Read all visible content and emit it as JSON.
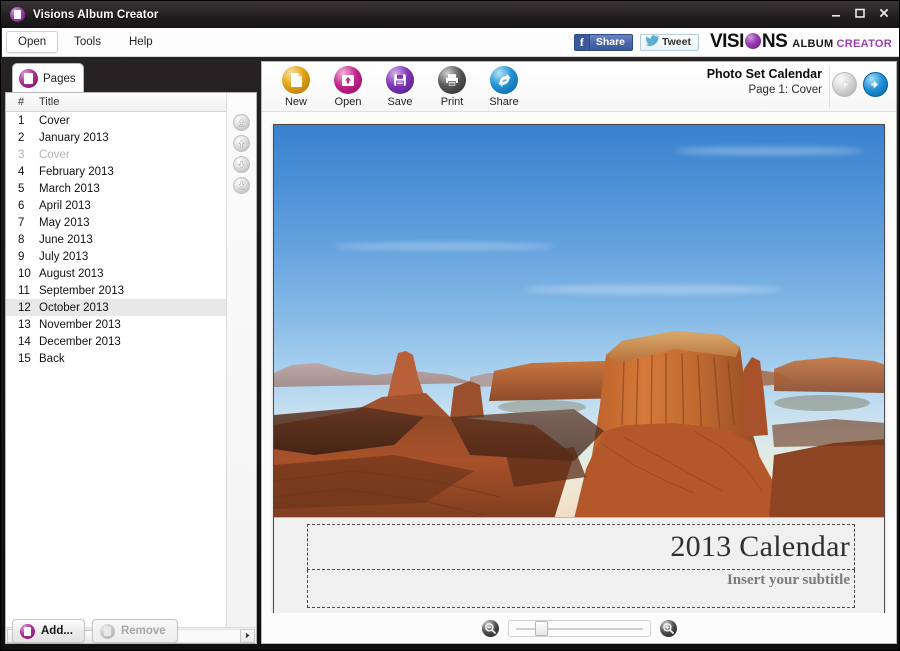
{
  "window": {
    "title": "Visions Album Creator",
    "app_icon": "page-orb-icon",
    "minimize": "minimize-icon",
    "maximize": "maximize-icon",
    "close": "close-icon"
  },
  "menubar": {
    "items": [
      {
        "label": "Open",
        "active": true
      },
      {
        "label": "Tools",
        "active": false
      },
      {
        "label": "Help",
        "active": false
      }
    ],
    "social": {
      "facebook_label": "Share",
      "facebook_glyph": "f",
      "twitter_label": "Tweet"
    },
    "logo": {
      "part1": "VISI",
      "part2": "NS",
      "album": "ALBUM",
      "creator": "CREATOR",
      "orb_color": "#9a3fb4"
    }
  },
  "sidebar": {
    "tab": {
      "label": "Pages",
      "icon": "pages-icon"
    },
    "columns": {
      "num": "#",
      "title": "Title"
    },
    "pages": [
      {
        "num": "1",
        "title": "Cover",
        "state": "normal"
      },
      {
        "num": "2",
        "title": "January 2013",
        "state": "normal"
      },
      {
        "num": "3",
        "title": "Cover",
        "state": "disabled"
      },
      {
        "num": "4",
        "title": "February 2013",
        "state": "normal"
      },
      {
        "num": "5",
        "title": "March 2013",
        "state": "normal"
      },
      {
        "num": "6",
        "title": "April 2013",
        "state": "normal"
      },
      {
        "num": "7",
        "title": "May 2013",
        "state": "normal"
      },
      {
        "num": "8",
        "title": "June 2013",
        "state": "normal"
      },
      {
        "num": "9",
        "title": "July 2013",
        "state": "normal"
      },
      {
        "num": "10",
        "title": "August 2013",
        "state": "normal"
      },
      {
        "num": "11",
        "title": "September 2013",
        "state": "normal"
      },
      {
        "num": "12",
        "title": "October 2013",
        "state": "hover"
      },
      {
        "num": "13",
        "title": "November 2013",
        "state": "normal"
      },
      {
        "num": "14",
        "title": "December 2013",
        "state": "normal"
      },
      {
        "num": "15",
        "title": "Back",
        "state": "normal"
      }
    ],
    "reorder_buttons": [
      {
        "name": "move-to-top-button",
        "icon": "arrow-up-to-bar-icon",
        "enabled": false
      },
      {
        "name": "move-up-button",
        "icon": "arrow-up-icon",
        "enabled": false
      },
      {
        "name": "move-down-button",
        "icon": "arrow-down-icon",
        "enabled": false
      },
      {
        "name": "move-to-bottom-button",
        "icon": "arrow-down-to-bar-icon",
        "enabled": false
      }
    ],
    "hscroll": {
      "left_arrow": "triangle-left-icon",
      "right_arrow": "triangle-right-icon",
      "thumb_grip": "|||"
    },
    "add_button": {
      "label": "Add...",
      "enabled": true
    },
    "remove_button": {
      "label": "Remove",
      "enabled": false
    }
  },
  "toolbar": {
    "tools": [
      {
        "label": "New",
        "icon": "new-page-icon",
        "color": "#e2a316"
      },
      {
        "label": "Open",
        "icon": "open-folder-icon",
        "color": "#c2258c"
      },
      {
        "label": "Save",
        "icon": "floppy-disk-icon",
        "color": "#7e35b8"
      },
      {
        "label": "Print",
        "icon": "printer-icon",
        "color": "#595959"
      },
      {
        "label": "Share",
        "icon": "share-arrows-icon",
        "color": "#1e93d6"
      }
    ]
  },
  "document": {
    "title": "Photo Set Calendar",
    "page_label": "Page 1: Cover",
    "nav_back": {
      "icon": "arrow-left-icon",
      "enabled": false
    },
    "nav_forward": {
      "icon": "arrow-right-icon",
      "enabled": true
    }
  },
  "canvas": {
    "photo_alt": "monument-valley-sunset-photo",
    "title_text": "2013 Calendar",
    "subtitle_text": "Insert your subtitle"
  },
  "zoom_control": {
    "zoom_out_icon": "magnifier-minus-icon",
    "zoom_in_icon": "magnifier-plus-icon",
    "slider_name": "zoom-slider"
  }
}
